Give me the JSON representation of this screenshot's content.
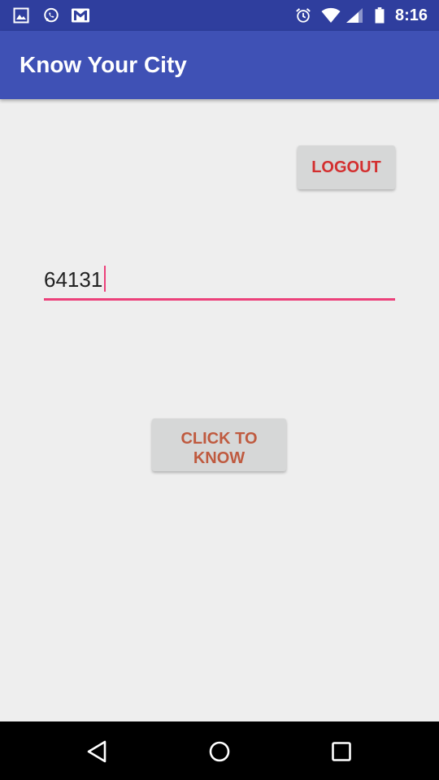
{
  "status_bar": {
    "time": "8:16",
    "icons": [
      "gallery-icon",
      "whatsapp-icon",
      "gmail-icon",
      "alarm-icon",
      "wifi-icon",
      "signal-icon",
      "battery-icon"
    ]
  },
  "app_bar": {
    "title": "Know Your City"
  },
  "main": {
    "logout_label": "LOGOUT",
    "pincode_value": "64131",
    "click_to_know_label": "CLICK TO\nKNOW"
  },
  "nav_bar": {
    "icons": [
      "back-icon",
      "home-icon",
      "recents-icon"
    ]
  },
  "colors": {
    "status_bar": "#2f3e9e",
    "app_bar": "#3f51b5",
    "background": "#eeeeee",
    "accent": "#ec407a",
    "logout_text": "#d32f2f",
    "know_text": "#bf5a3f"
  }
}
